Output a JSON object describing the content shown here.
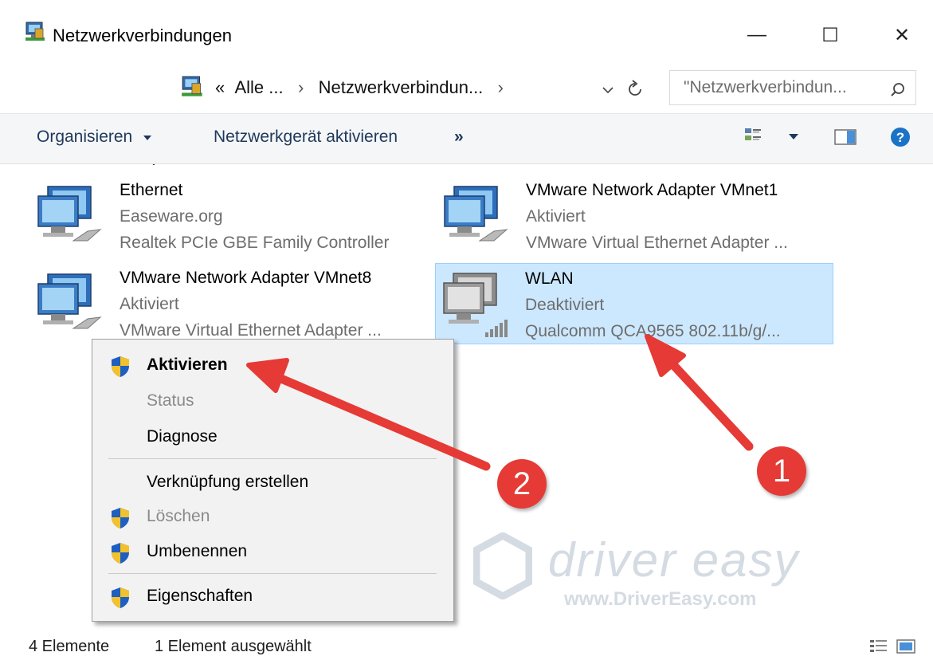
{
  "window": {
    "title": "Netzwerkverbindungen",
    "controls": {
      "minimize": "—",
      "maximize": "☐",
      "close": "✕"
    }
  },
  "nav": {
    "back_icon": "back-arrow-icon",
    "forward_icon": "forward-arrow-icon",
    "breadcrumb_prefix": "«",
    "breadcrumb": [
      "Alle ...",
      "Netzwerkverbindun..."
    ],
    "breadcrumb_sep": "›",
    "search_placeholder": "\"Netzwerkverbindun..."
  },
  "toolbar": {
    "organize": "Organisieren",
    "activate_device": "Netzwerkgerät aktivieren",
    "more": "»"
  },
  "connections": [
    {
      "name": "Ethernet",
      "status": "Easeware.org",
      "adapter": "Realtek PCIe GBE Family Controller",
      "type": "wired",
      "selected": false
    },
    {
      "name": "VMware Network Adapter VMnet1",
      "status": "Aktiviert",
      "adapter": "VMware Virtual Ethernet Adapter ...",
      "type": "wired",
      "selected": false
    },
    {
      "name": "VMware Network Adapter VMnet8",
      "status": "Aktiviert",
      "adapter": "VMware Virtual Ethernet Adapter ...",
      "type": "wired",
      "selected": false
    },
    {
      "name": "WLAN",
      "status": "Deaktiviert",
      "adapter": "Qualcomm QCA9565 802.11b/g/...",
      "type": "wireless",
      "selected": true
    }
  ],
  "context_menu": {
    "items": [
      {
        "label": "Aktivieren",
        "shield": true,
        "bold": true,
        "disabled": false
      },
      {
        "label": "Status",
        "shield": false,
        "bold": false,
        "disabled": true
      },
      {
        "label": "Diagnose",
        "shield": false,
        "bold": false,
        "disabled": false
      },
      {
        "label": "Verknüpfung erstellen",
        "shield": false,
        "bold": false,
        "disabled": false
      },
      {
        "label": "Löschen",
        "shield": true,
        "bold": false,
        "disabled": true
      },
      {
        "label": "Umbenennen",
        "shield": true,
        "bold": false,
        "disabled": false
      },
      {
        "label": "Eigenschaften",
        "shield": true,
        "bold": false,
        "disabled": false
      }
    ]
  },
  "annotations": {
    "badge1": "1",
    "badge2": "2",
    "accent": "#e53a35"
  },
  "watermark": {
    "logo": "driver easy",
    "url": "www.DriverEasy.com"
  },
  "status": {
    "count": "4 Elemente",
    "selection": "1 Element ausgewählt"
  },
  "colors": {
    "selection_bg": "#cce8ff",
    "link": "#1e395b",
    "help": "#1a73c7"
  }
}
